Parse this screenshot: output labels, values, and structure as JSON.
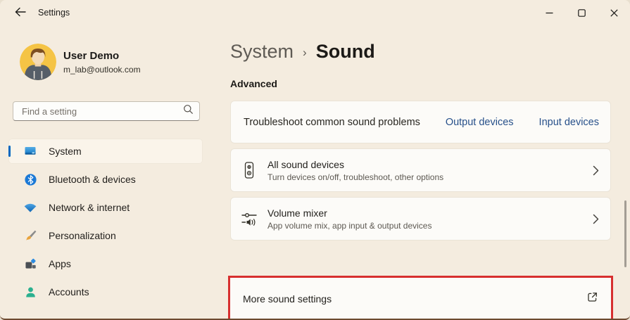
{
  "titlebar": {
    "app_title": "Settings",
    "controls": {
      "minimize": "minimize-icon",
      "maximize": "maximize-icon",
      "close": "close-icon"
    }
  },
  "user": {
    "name": "User Demo",
    "email": "m_lab@outlook.com"
  },
  "search": {
    "placeholder": "Find a setting"
  },
  "sidebar": {
    "items": [
      {
        "label": "System",
        "icon": "system-icon",
        "selected": true
      },
      {
        "label": "Bluetooth & devices",
        "icon": "bluetooth-icon",
        "selected": false
      },
      {
        "label": "Network & internet",
        "icon": "network-icon",
        "selected": false
      },
      {
        "label": "Personalization",
        "icon": "personalization-icon",
        "selected": false
      },
      {
        "label": "Apps",
        "icon": "apps-icon",
        "selected": false
      },
      {
        "label": "Accounts",
        "icon": "accounts-icon",
        "selected": false
      }
    ]
  },
  "breadcrumb": {
    "parent": "System",
    "separator": "›",
    "current": "Sound"
  },
  "section": {
    "label": "Advanced"
  },
  "cards": {
    "troubleshoot": {
      "label": "Troubleshoot common sound problems",
      "links": [
        "Output devices",
        "Input devices"
      ]
    },
    "all_sound_devices": {
      "title": "All sound devices",
      "subtitle": "Turn devices on/off, troubleshoot, other options"
    },
    "volume_mixer": {
      "title": "Volume mixer",
      "subtitle": "App volume mix, app input & output devices"
    },
    "more_sound_settings": {
      "title": "More sound settings"
    }
  },
  "colors": {
    "window_background": "#f4ecdf",
    "card_background": "#fcfbf8",
    "accent_blue": "#0067c0",
    "link_blue": "#27508a",
    "highlight_red": "#d72f2f",
    "avatar_yellow": "#f5c445",
    "accounts_teal": "#2bb08f"
  }
}
